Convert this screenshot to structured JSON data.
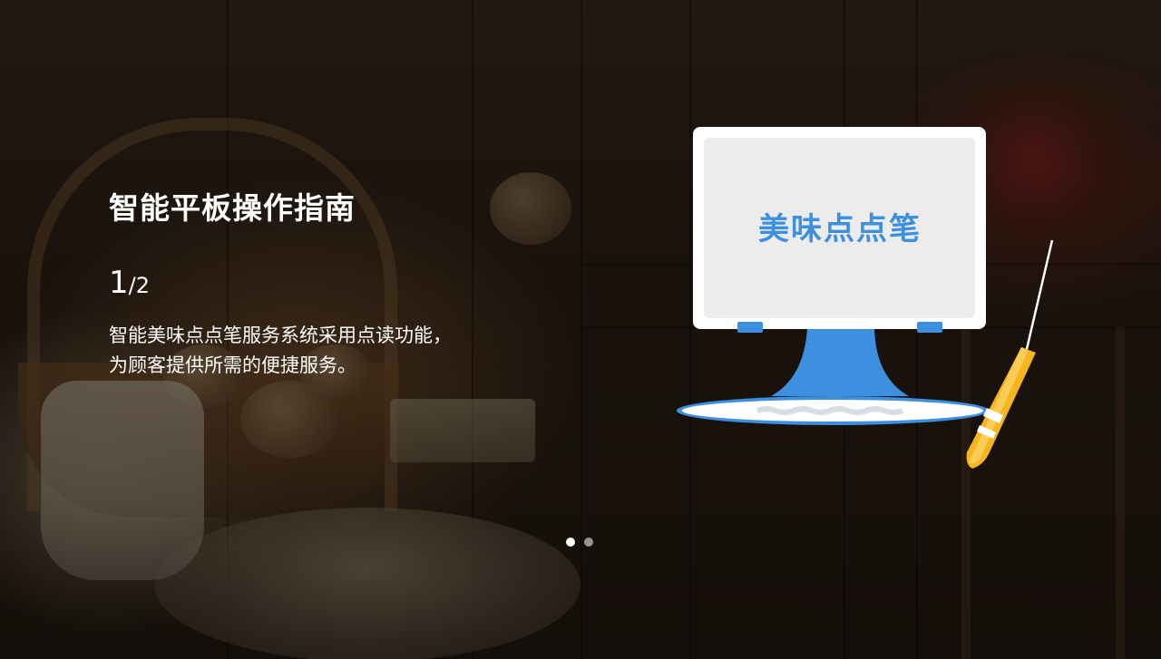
{
  "guide": {
    "title": "智能平板操作指南",
    "page": {
      "current": "1",
      "separator": "/",
      "total": "2"
    },
    "description_lines": [
      "智能美味点点笔服务系统采用点读功能，",
      "为顾客提供所需的便捷服务。"
    ]
  },
  "illustration": {
    "screen_text": "美味点点笔"
  },
  "pager": {
    "count": 2,
    "active_index": 0
  },
  "colors": {
    "accent_blue": "#3d8fdf",
    "screen_bg": "#ececec",
    "monitor_frame": "#ffffff",
    "pen_yellow": "#f5b51c",
    "text": "#ffffff"
  }
}
